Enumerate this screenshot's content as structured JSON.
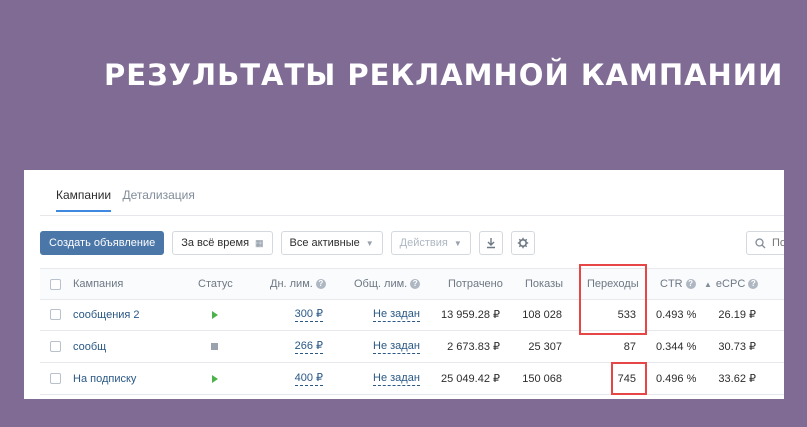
{
  "headline": "РЕЗУЛЬТАТЫ РЕКЛАМНОЙ КАМПАНИИ",
  "tabs": [
    {
      "label": "Кампании",
      "active": true
    },
    {
      "label": "Детализация",
      "active": false
    }
  ],
  "toolbar": {
    "create_label": "Создать объявление",
    "period_label": "За всё время",
    "filter_label": "Все активные",
    "actions_label": "Действия",
    "download_icon": "download-icon",
    "settings_icon": "gear-icon",
    "search_placeholder": "По"
  },
  "columns": {
    "campaign": "Кампания",
    "status": "Статус",
    "day_limit": "Дн. лим.",
    "total_limit": "Общ. лим.",
    "spent": "Потрачено",
    "impressions": "Показы",
    "clicks": "Переходы",
    "ctr": "CTR",
    "ecpc": "eCPC"
  },
  "rows": [
    {
      "name": "сообщения 2",
      "status": "active",
      "day_limit": "300 ₽",
      "total_limit": "Не задан",
      "spent": "13 959.28 ₽",
      "impressions": "108 028",
      "clicks": "533",
      "ctr": "0.493 %",
      "ecpc": "26.19 ₽"
    },
    {
      "name": "сообщ",
      "status": "stopped",
      "day_limit": "266 ₽",
      "total_limit": "Не задан",
      "spent": "2 673.83 ₽",
      "impressions": "25 307",
      "clicks": "87",
      "ctr": "0.344 %",
      "ecpc": "30.73 ₽"
    },
    {
      "name": "На подписку",
      "status": "active",
      "day_limit": "400 ₽",
      "total_limit": "Не задан",
      "spent": "25 049.42 ₽",
      "impressions": "150 068",
      "clicks": "745",
      "ctr": "0.496 %",
      "ecpc": "33.62 ₽"
    }
  ],
  "colors": {
    "background": "#7f6b94",
    "highlight": "#e64646",
    "accent": "#4a76a8",
    "active_status": "#4bb34b"
  }
}
